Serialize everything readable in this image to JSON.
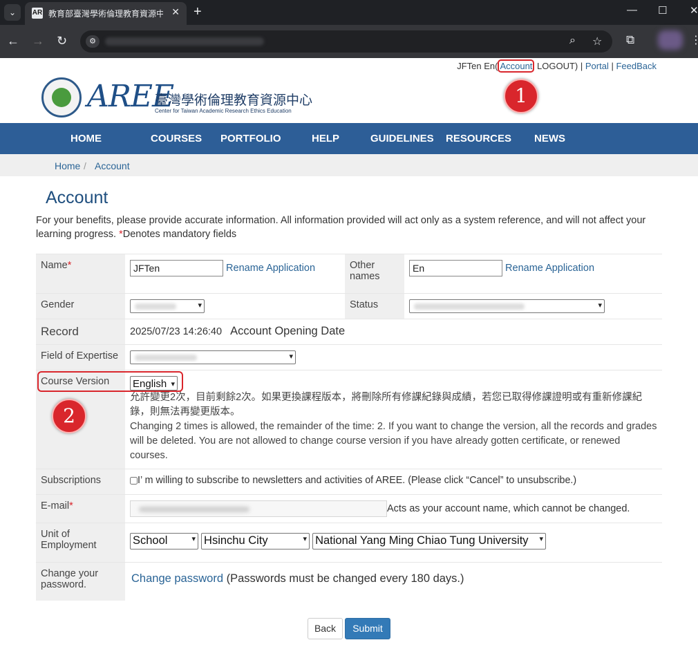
{
  "browser": {
    "tab_title": "教育部臺灣學術倫理教育資源中",
    "tab_favicon": "AR",
    "new_tab": "+",
    "close_tab": "✕",
    "window_controls": {
      "minimize": "—",
      "maximize": "☐",
      "close": "✕"
    }
  },
  "header": {
    "user_prefix": "JFTen En(",
    "account_link": "Account",
    "logout": " LOGOUT)",
    "sep1": " | ",
    "portal": "Portal",
    "sep2": " | ",
    "feedback": "FeedBack",
    "marker1": "1",
    "marker2": "2",
    "logo_aree": "AREE",
    "logo_cn": "臺灣學術倫理教育資源中心",
    "logo_en": "Center for Taiwan Academic Research Ethics Education"
  },
  "nav": [
    "HOME",
    "COURSES",
    "PORTFOLIO",
    "HELP",
    "GUIDELINES",
    "RESOURCES",
    "NEWS"
  ],
  "breadcrumb": {
    "home": "Home",
    "sep": "/",
    "current": "Account"
  },
  "page": {
    "title": "Account",
    "intro": "For your benefits, please provide accurate information. All information provided will act only as a system reference, and will not affect your learning progress. ",
    "intro_star": "*",
    "intro_tail": "Denotes mandatory fields"
  },
  "form": {
    "name_label": "Name",
    "req_star": "*",
    "name_value": "JFTen",
    "rename": "Rename Application",
    "other_names_label": "Other names",
    "other_names_value": "En",
    "gender_label": "Gender",
    "status_label": "Status",
    "record_label": "Record",
    "record_date": "2025/07/23 14:26:40",
    "record_desc": "Account Opening Date",
    "expertise_label": "Field of Expertise",
    "course_version_label": "Course Version",
    "course_version_value": "English",
    "course_note_cn": "允許變更2次，目前剩餘2次。如果更換課程版本，將刪除所有修課紀錄與成績，若您已取得修課證明或有重新修課紀錄，則無法再變更版本。",
    "course_note_en": "Changing 2 times is allowed, the remainder of the time: 2. If you want to change the version, all the records and grades will be deleted. You are not allowed to change course version if you have already gotten certificate, or renewed courses.",
    "subscriptions_label": "Subscriptions",
    "subscription_text": "I’ m willing to subscribe to newsletters and activities of AREE. (Please click “Cancel” to unsubscribe.)",
    "email_label": "E-mail",
    "email_note": "Acts as your account name, which cannot be changed.",
    "unit_label": "Unit of Employment",
    "unit_type": "School",
    "unit_city": "Hsinchu City",
    "unit_school": "National Yang Ming Chiao Tung University",
    "password_label": "Change your password.",
    "change_password": "Change password",
    "password_note": " (Passwords must be changed every 180 days.)"
  },
  "buttons": {
    "back": "Back",
    "submit": "Submit"
  },
  "colors": {
    "nav_bg": "#2d5e97",
    "accent_red": "#d9262c",
    "submit_bg": "#337ab7",
    "link": "#2a6496"
  }
}
